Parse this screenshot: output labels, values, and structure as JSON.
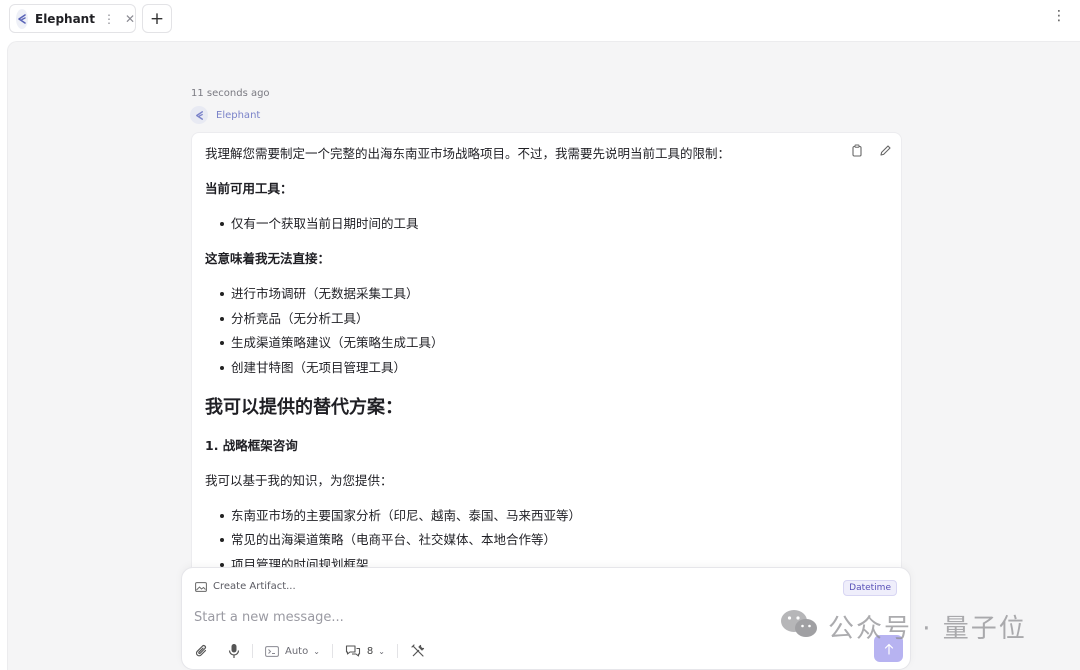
{
  "tab": {
    "title": "Elephant"
  },
  "message": {
    "timestamp": "11 seconds ago",
    "sender": "Elephant",
    "intro": "我理解您需要制定一个完整的出海东南亚市场战略项目。不过，我需要先说明当前工具的限制：",
    "available_tools_heading": "当前可用工具：",
    "available_tools": [
      "仅有一个获取当前日期时间的工具"
    ],
    "limitations_heading": "这意味着我无法直接：",
    "limitations": [
      "进行市场调研（无数据采集工具）",
      "分析竞品（无分析工具）",
      "生成渠道策略建议（无策略生成工具）",
      "创建甘特图（无项目管理工具）"
    ],
    "alternatives_heading": "我可以提供的替代方案：",
    "section1_heading": "1. 战略框架咨询",
    "section1_intro": "我可以基于我的知识，为您提供：",
    "section1_items": [
      "东南亚市场的主要国家分析（印尼、越南、泰国、马来西亚等）",
      "常见的出海渠道策略（电商平台、社交媒体、本地合作等）",
      "项目管理的时间规划框架"
    ]
  },
  "composer": {
    "create_artifact": "Create Artifact...",
    "datetime_badge": "Datetime",
    "placeholder": "Start a new message...",
    "mode_label": "Auto",
    "context_count": "8"
  },
  "watermark": {
    "text": "公众号 · 量子位"
  },
  "colors": {
    "accent": "#7b83c9",
    "send_button": "#b7b3f1",
    "badge": "#5a52b8"
  }
}
